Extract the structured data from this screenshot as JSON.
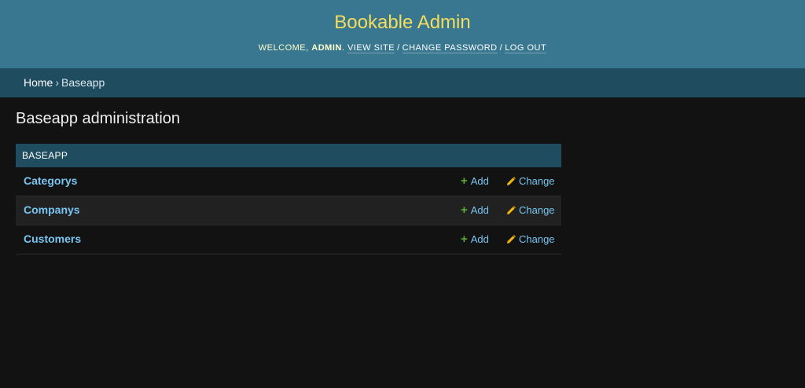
{
  "header": {
    "site_name": "Bookable Admin",
    "welcome": "Welcome,",
    "username": "admin",
    "period": ".",
    "view_site": "View site",
    "change_password": "Change password",
    "log_out": "Log out",
    "separator": "/"
  },
  "breadcrumbs": {
    "home": "Home",
    "separator": "›",
    "current": "Baseapp"
  },
  "main": {
    "title": "Baseapp administration",
    "module_caption": "BASEAPP",
    "models": [
      {
        "name": "Categorys",
        "add": "Add",
        "change": "Change"
      },
      {
        "name": "Companys",
        "add": "Add",
        "change": "Change"
      },
      {
        "name": "Customers",
        "add": "Add",
        "change": "Change"
      }
    ]
  },
  "colors": {
    "header_bg": "#38778f",
    "breadcrumbs_bg": "#1f4c5f",
    "site_name": "#f5dd5d",
    "link": "#79c5f2",
    "add_icon": "#5ab034",
    "change_icon": "#efb80b",
    "page_bg": "#121212"
  },
  "icons": {
    "add": "plus-icon",
    "change": "pencil-icon"
  }
}
